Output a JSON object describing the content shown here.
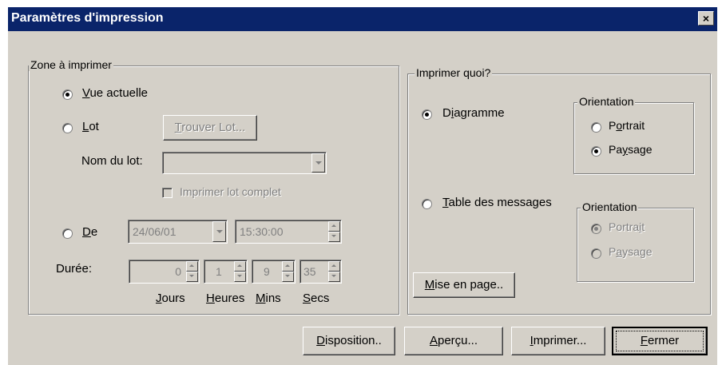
{
  "window": {
    "title": "Paramètres d'impression",
    "close_glyph": "×"
  },
  "zone": {
    "legend": "Zone à imprimer",
    "current_view": {
      "accel": "V",
      "rest": "ue actuelle",
      "checked": true
    },
    "batch": {
      "accel": "L",
      "rest": "ot",
      "checked": false
    },
    "find_batch": {
      "accel": "T",
      "rest": "rouver Lot..."
    },
    "batch_name_label": "Nom du lot:",
    "batch_name_value": "",
    "print_complete": "Imprimer lot complet",
    "from": {
      "accel": "D",
      "rest": "e",
      "checked": false
    },
    "date": "24/06/01",
    "time": "15:30:00",
    "duration_label": "Durée:",
    "days": "0",
    "hours": "1",
    "mins": "9",
    "secs": "35",
    "days_label": {
      "accel": "J",
      "rest": "ours"
    },
    "hours_label": {
      "accel": "H",
      "rest": "eures"
    },
    "mins_label": {
      "accel": "M",
      "rest": "ins"
    },
    "secs_label": {
      "accel": "S",
      "rest": "ecs"
    }
  },
  "what": {
    "legend": "Imprimer quoi?",
    "diagram": {
      "pre": "D",
      "accel": "i",
      "rest": "agramme",
      "checked": true
    },
    "messages": {
      "accel": "T",
      "rest": "able des messages",
      "checked": false
    },
    "orientation1": {
      "legend": "Orientation",
      "portrait": {
        "pre": "P",
        "accel": "o",
        "rest": "rtrait",
        "checked": false
      },
      "paysage": {
        "pre": "Pa",
        "accel": "y",
        "rest": "sage",
        "checked": true
      }
    },
    "orientation2": {
      "legend": "Orientation",
      "portrait": {
        "pre": "Portra",
        "accel": "i",
        "rest": "t",
        "checked": true
      },
      "paysage": {
        "pre": "P",
        "accel": "a",
        "rest": "ysage",
        "checked": false
      }
    },
    "page_setup": {
      "accel": "M",
      "rest": "ise en page.."
    }
  },
  "buttons": {
    "layout": {
      "accel": "D",
      "rest": "isposition.."
    },
    "preview": {
      "accel": "A",
      "rest": "perçu..."
    },
    "print": {
      "accel": "I",
      "rest": "mprimer..."
    },
    "close": {
      "accel": "F",
      "rest": "ermer"
    }
  }
}
